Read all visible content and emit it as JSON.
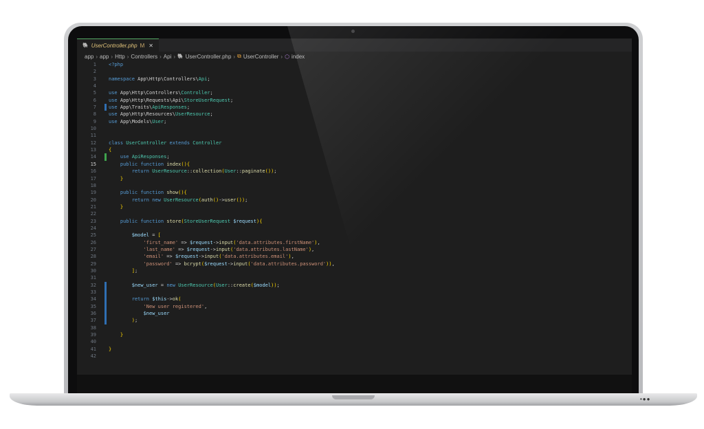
{
  "editor": {
    "tab": {
      "filename": "UserController.php",
      "modified": "M",
      "close": "✕"
    },
    "breadcrumb": [
      "app",
      "app",
      "Http",
      "Controllers",
      "Api",
      "UserController.php",
      "UserController",
      "index"
    ],
    "active_line": 15,
    "lines": [
      {
        "n": "1",
        "t": "<?php"
      },
      {
        "n": "2",
        "t": ""
      },
      {
        "n": "3",
        "t": "namespace App\\Http\\Controllers\\Api;"
      },
      {
        "n": "4",
        "t": ""
      },
      {
        "n": "5",
        "t": "use App\\Http\\Controllers\\Controller;"
      },
      {
        "n": "6",
        "t": "use App\\Http\\Requests\\Api\\StoreUserRequest;"
      },
      {
        "n": "7",
        "t": "use App\\Traits\\ApiResponses;"
      },
      {
        "n": "8",
        "t": "use App\\Http\\Resources\\UserResource;"
      },
      {
        "n": "9",
        "t": "use App\\Models\\User;"
      },
      {
        "n": "10",
        "t": ""
      },
      {
        "n": "11",
        "t": ""
      },
      {
        "n": "12",
        "t": "class UserController extends Controller"
      },
      {
        "n": "13",
        "t": "{"
      },
      {
        "n": "14",
        "t": "    use ApiResponses;"
      },
      {
        "n": "15",
        "t": "    public function index(){"
      },
      {
        "n": "16",
        "t": "        return UserResource::collection(User::paginate());"
      },
      {
        "n": "17",
        "t": "    }"
      },
      {
        "n": "18",
        "t": ""
      },
      {
        "n": "19",
        "t": "    public function show(){"
      },
      {
        "n": "20",
        "t": "        return new UserResource(auth()->user());"
      },
      {
        "n": "21",
        "t": "    }"
      },
      {
        "n": "22",
        "t": ""
      },
      {
        "n": "23",
        "t": "    public function store(StoreUserRequest $request){"
      },
      {
        "n": "24",
        "t": ""
      },
      {
        "n": "25",
        "t": "        $model = ["
      },
      {
        "n": "26",
        "t": "            'first_name' => $request->input('data.attributes.firstName'),"
      },
      {
        "n": "27",
        "t": "            'last_name' => $request->input('data.attributes.lastName'),"
      },
      {
        "n": "28",
        "t": "            'email' => $request->input('data.attributes.email'),"
      },
      {
        "n": "29",
        "t": "            'password' => bcrypt($request->input('data.attributes.password')),"
      },
      {
        "n": "30",
        "t": "        ];"
      },
      {
        "n": "31",
        "t": ""
      },
      {
        "n": "32",
        "t": "        $new_user = new UserResource(User::create($model));"
      },
      {
        "n": "33",
        "t": ""
      },
      {
        "n": "34",
        "t": "        return $this->ok("
      },
      {
        "n": "35",
        "t": "            'New user registered',"
      },
      {
        "n": "36",
        "t": "            $new_user"
      },
      {
        "n": "37",
        "t": "        );"
      },
      {
        "n": "38",
        "t": ""
      },
      {
        "n": "39",
        "t": "    }"
      },
      {
        "n": "40",
        "t": ""
      },
      {
        "n": "41",
        "t": "}"
      },
      {
        "n": "42",
        "t": ""
      }
    ],
    "gutter_marks": {
      "7": "b",
      "14": "g",
      "32": "b",
      "33": "b",
      "34": "b",
      "35": "b",
      "36": "b",
      "37": "b"
    }
  },
  "colors": {
    "background": "#1e1e1e",
    "keyword": "#569cd6",
    "class": "#4ec9b0",
    "function": "#dcdcaa",
    "variable": "#9cdcfe",
    "string": "#ce9178"
  }
}
